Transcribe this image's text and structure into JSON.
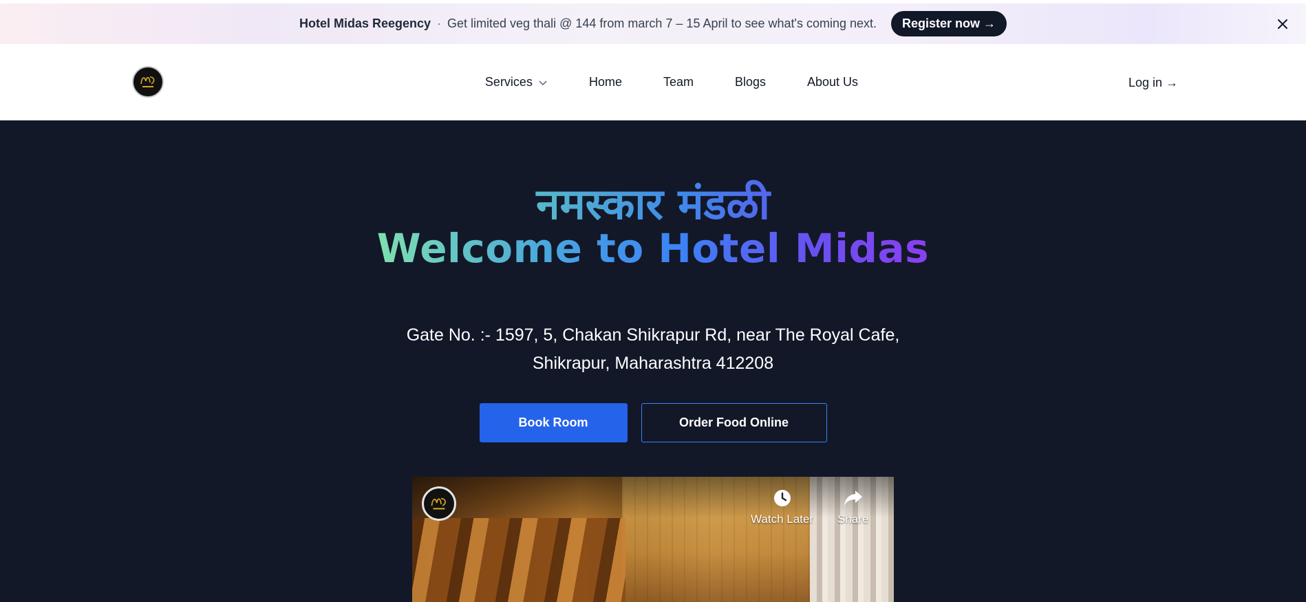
{
  "banner": {
    "brand": "Hotel Midas Reegency",
    "separator": "·",
    "message": "Get limited veg thali @ 144 from march 7 – 15 April to see what's coming next.",
    "cta_label": "Register now →",
    "close_icon": "close-icon"
  },
  "header": {
    "logo_icon": "hotel-logo",
    "nav": {
      "services": "Services",
      "home": "Home",
      "team": "Team",
      "blogs": "Blogs",
      "about": "About Us"
    },
    "login_label": "Log in →"
  },
  "hero": {
    "greeting": "नमस्कार मंडळी",
    "title": "Welcome to Hotel Midas",
    "address_line1": "Gate No. :- 1597, 5, Chakan Shikrapur Rd, near The Royal Cafe,",
    "address_line2": "Shikrapur, Maharashtra 412208",
    "book_label": "Book Room",
    "order_label": "Order Food Online"
  },
  "video": {
    "channel_icon": "channel-logo",
    "watch_later_label": "Watch Later",
    "share_label": "Share"
  },
  "colors": {
    "hero_bg": "#121828",
    "primary": "#2563eb",
    "banner_button": "#111827"
  }
}
